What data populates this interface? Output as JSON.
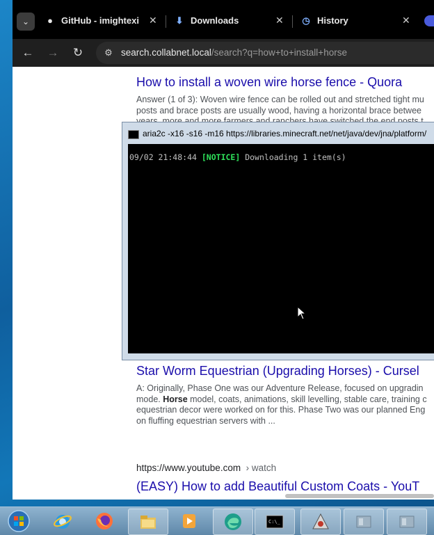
{
  "browser": {
    "tabs": [
      {
        "label": "GitHub - imightexist",
        "icon": "github-icon",
        "active": false
      },
      {
        "label": "Downloads",
        "icon": "download-icon",
        "active": false
      },
      {
        "label": "History",
        "icon": "history-icon",
        "active": true
      }
    ],
    "address": {
      "host": "search.collabnet.local",
      "path": "/search?q=how+to+install+horse"
    }
  },
  "results": [
    {
      "title": "How to install a woven wire horse fence - Quora",
      "snippet_lines": [
        "Answer (1 of 3): Woven wire fence can be rolled out and stretched tight mu",
        "posts and brace posts are usually wood, having a horizontal brace betwee",
        "years, more and more farmers and ranchers have switched the end posts t"
      ]
    },
    {
      "title": "Star Worm Equestrian (Upgrading Horses) - Cursel",
      "snippet_lines": [
        "A: Originally, Phase One was our Adventure Release, focused on upgradin",
        "mode. ",
        "Horse",
        " model, coats, animations, skill levelling, stable care, training c",
        "equestrian decor were worked on for this. Phase Two was our planned Eng",
        "on fluffing equestrian servers with ..."
      ]
    },
    {
      "cite_host": "https://www.youtube.com",
      "cite_crumb": "› watch",
      "title": "(EASY) How to add Beautiful Custom Coats - YouT"
    }
  ],
  "console": {
    "title": "aria2c  -x16 -s16 -m16 https://libraries.minecraft.net/net/java/dev/jna/platform/",
    "timestamp": "09/02 21:48:44",
    "tag": "[NOTICE]",
    "message": "Downloading 1 item(s)"
  },
  "taskbar": {
    "items": [
      "start-orb-icon",
      "internet-explorer-icon",
      "firefox-icon",
      "file-explorer-icon",
      "media-player-icon",
      "edge-icon",
      "command-prompt-icon",
      "java-icon",
      "window-icon",
      "window-icon"
    ]
  },
  "colors": {
    "link": "#1a0dab",
    "notice": "#2ee05a",
    "console_bg": "#000000"
  }
}
